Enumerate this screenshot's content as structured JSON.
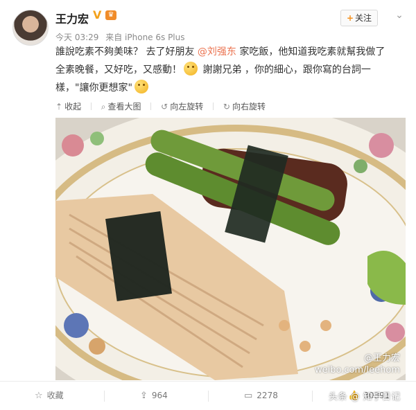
{
  "user": {
    "name": "王力宏",
    "vip_badge": "V",
    "time": "今天 03:29",
    "source": "来自 iPhone 6s Plus"
  },
  "header": {
    "follow_plus": "+",
    "follow_label": "关注",
    "menu_icon": "chevron-down-icon"
  },
  "post": {
    "line1_a": "誰說吃素不夠美味？ 去了好朋友 ",
    "mention": "@刘强东",
    "line1_b": " 家吃飯，他知道我吃素就幫我做了",
    "line2_a": "全素晚餐，又好吃，又感動！",
    "line2_b": " 謝謝兄弟 ，你的細心，跟你寫的台詞一",
    "line3_a": "樣，\"讓你更想家\""
  },
  "toolbar": {
    "collapse": "收起",
    "view_large": "查看大图",
    "rotate_left": "向左旋转",
    "rotate_right": "向右旋转"
  },
  "photo": {
    "watermark_user": "@王力宏",
    "watermark_url": "weibo.com/leehom"
  },
  "footer": {
    "favorite": "收藏",
    "repost_count": "964",
    "comment_count": "2278",
    "like_count": "30391"
  },
  "overlay": {
    "text": "头条 @ 知乎日记"
  },
  "colors": {
    "mention": "#eb7350",
    "follow_plus": "#f68f1b",
    "vip": "#f3a21c"
  }
}
